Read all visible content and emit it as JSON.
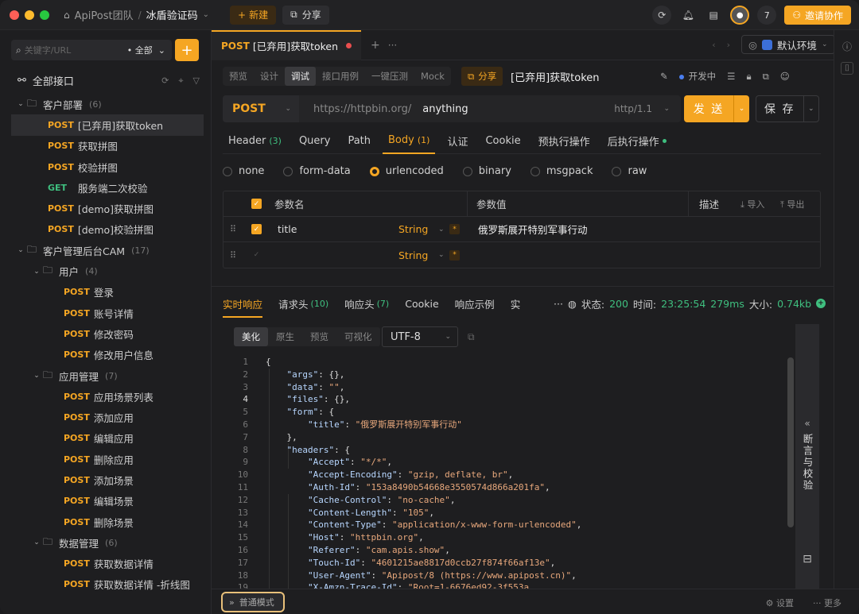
{
  "titlebar": {
    "team": "ApiPost团队",
    "separator": "/",
    "project": "冰盾验证码",
    "new_label": "新建",
    "share_label": "分享",
    "member_count": "7",
    "invite_label": "邀请协作"
  },
  "sidebar": {
    "search_placeholder": "关键字/URL",
    "filter": "全部",
    "all_label": "全部接口",
    "tree": [
      {
        "kind": "folder",
        "level": 0,
        "label": "客户部署",
        "count": "(6)"
      },
      {
        "kind": "api",
        "level": 1,
        "method": "POST",
        "label": "[已弃用]获取token",
        "selected": true
      },
      {
        "kind": "api",
        "level": 1,
        "method": "POST",
        "label": "获取拼图"
      },
      {
        "kind": "api",
        "level": 1,
        "method": "POST",
        "label": "校验拼图"
      },
      {
        "kind": "api",
        "level": 1,
        "method": "GET",
        "label": "服务端二次校验"
      },
      {
        "kind": "api",
        "level": 1,
        "method": "POST",
        "label": "[demo]获取拼图"
      },
      {
        "kind": "api",
        "level": 1,
        "method": "POST",
        "label": "[demo]校验拼图"
      },
      {
        "kind": "folder",
        "level": 0,
        "label": "客户管理后台CAM",
        "count": "(17)"
      },
      {
        "kind": "folder",
        "level": 1,
        "label": "用户",
        "count": "(4)"
      },
      {
        "kind": "api",
        "level": 2,
        "method": "POST",
        "label": "登录"
      },
      {
        "kind": "api",
        "level": 2,
        "method": "POST",
        "label": "账号详情"
      },
      {
        "kind": "api",
        "level": 2,
        "method": "POST",
        "label": "修改密码"
      },
      {
        "kind": "api",
        "level": 2,
        "method": "POST",
        "label": "修改用户信息"
      },
      {
        "kind": "folder",
        "level": 1,
        "label": "应用管理",
        "count": "(7)"
      },
      {
        "kind": "api",
        "level": 2,
        "method": "POST",
        "label": "应用场景列表"
      },
      {
        "kind": "api",
        "level": 2,
        "method": "POST",
        "label": "添加应用"
      },
      {
        "kind": "api",
        "level": 2,
        "method": "POST",
        "label": "编辑应用"
      },
      {
        "kind": "api",
        "level": 2,
        "method": "POST",
        "label": "删除应用"
      },
      {
        "kind": "api",
        "level": 2,
        "method": "POST",
        "label": "添加场景"
      },
      {
        "kind": "api",
        "level": 2,
        "method": "POST",
        "label": "编辑场景"
      },
      {
        "kind": "api",
        "level": 2,
        "method": "POST",
        "label": "删除场景"
      },
      {
        "kind": "folder",
        "level": 1,
        "label": "数据管理",
        "count": "(6)"
      },
      {
        "kind": "api",
        "level": 2,
        "method": "POST",
        "label": "获取数据详情"
      },
      {
        "kind": "api",
        "level": 2,
        "method": "POST",
        "label": "获取数据详情 -折线图"
      }
    ]
  },
  "tabs": {
    "active_method": "POST",
    "active_title": "[已弃用]获取token",
    "environment": "默认环境"
  },
  "subtabs": [
    "预览",
    "设计",
    "调试",
    "接口用例",
    "一键压测",
    "Mock"
  ],
  "subtab_active": 2,
  "share_label": "分享",
  "request_name": "[已弃用]获取token",
  "dev_status": "开发中",
  "url": {
    "method": "POST",
    "base": "https://httpbin.org/",
    "path": "anything",
    "protocol": "http/1.1",
    "send_label": "发 送",
    "save_label": "保 存"
  },
  "param_tabs": [
    {
      "label": "Header",
      "count": "(3)"
    },
    {
      "label": "Query",
      "count": ""
    },
    {
      "label": "Path",
      "count": ""
    },
    {
      "label": "Body",
      "count": "(1)",
      "active": true
    },
    {
      "label": "认证",
      "count": ""
    },
    {
      "label": "Cookie",
      "count": ""
    },
    {
      "label": "预执行操作",
      "count": ""
    },
    {
      "label": "后执行操作",
      "count": "",
      "dot": true
    }
  ],
  "body_types": [
    "none",
    "form-data",
    "urlencoded",
    "binary",
    "msgpack",
    "raw"
  ],
  "body_type_active": 2,
  "param_table": {
    "headers": {
      "name": "参数名",
      "value": "参数值",
      "desc": "描述",
      "import": "导入",
      "export": "导出"
    },
    "rows": [
      {
        "checked": true,
        "name": "title",
        "type": "String",
        "value": "俄罗斯展开特别军事行动"
      },
      {
        "checked": false,
        "name": "",
        "type": "String",
        "value": ""
      }
    ]
  },
  "response": {
    "tabs": [
      {
        "label": "实时响应",
        "count": "",
        "active": true
      },
      {
        "label": "请求头",
        "count": "(10)"
      },
      {
        "label": "响应头",
        "count": "(7)"
      },
      {
        "label": "Cookie",
        "count": ""
      },
      {
        "label": "响应示例",
        "count": ""
      },
      {
        "label": "实",
        "count": ""
      }
    ],
    "more": "···",
    "status_label": "状态:",
    "status": "200",
    "time_label": "时间:",
    "time": "23:25:54",
    "duration": "279ms",
    "size_label": "大小:",
    "size": "0.74kb",
    "format_tabs": [
      "美化",
      "原生",
      "预览",
      "可视化"
    ],
    "format_active": 0,
    "encoding": "UTF-8",
    "code_lines": [
      {
        "n": "1",
        "t": "{"
      },
      {
        "n": "2",
        "t": "    \"args\": {},"
      },
      {
        "n": "3",
        "t": "    \"data\": \"\","
      },
      {
        "n": "4",
        "t": "    \"files\": {},"
      },
      {
        "n": "5",
        "t": "    \"form\": {"
      },
      {
        "n": "6",
        "t": "        \"title\": \"俄罗斯展开特别军事行动\""
      },
      {
        "n": "7",
        "t": "    },"
      },
      {
        "n": "8",
        "t": "    \"headers\": {"
      },
      {
        "n": "9",
        "t": "        \"Accept\": \"*/*\","
      },
      {
        "n": "10",
        "t": "        \"Accept-Encoding\": \"gzip, deflate, br\","
      },
      {
        "n": "11",
        "t": "        \"Auth-Id\": \"153a8490b54668e3550574d866a201fa\","
      },
      {
        "n": "12",
        "t": "        \"Cache-Control\": \"no-cache\","
      },
      {
        "n": "13",
        "t": "        \"Content-Length\": \"105\","
      },
      {
        "n": "14",
        "t": "        \"Content-Type\": \"application/x-www-form-urlencoded\","
      },
      {
        "n": "15",
        "t": "        \"Host\": \"httpbin.org\","
      },
      {
        "n": "16",
        "t": "        \"Referer\": \"cam.apis.show\","
      },
      {
        "n": "17",
        "t": "        \"Touch-Id\": \"4601215ae8817d0ccb27f874f66af13e\","
      },
      {
        "n": "18",
        "t": "        \"User-Agent\": \"Apipost/8 (https://www.apipost.cn)\","
      },
      {
        "n": "19",
        "t": "        \"X-Amzn-Trace-Id\": \"Root=1-6676ed92-3f553a"
      }
    ],
    "assert_panel": "断言与校验"
  },
  "bottom": {
    "mode": "普通模式",
    "settings": "设置",
    "more": "更多"
  },
  "colors": {
    "accent": "#f5a623",
    "get": "#3fbf7f",
    "background": "#1e1e20"
  }
}
